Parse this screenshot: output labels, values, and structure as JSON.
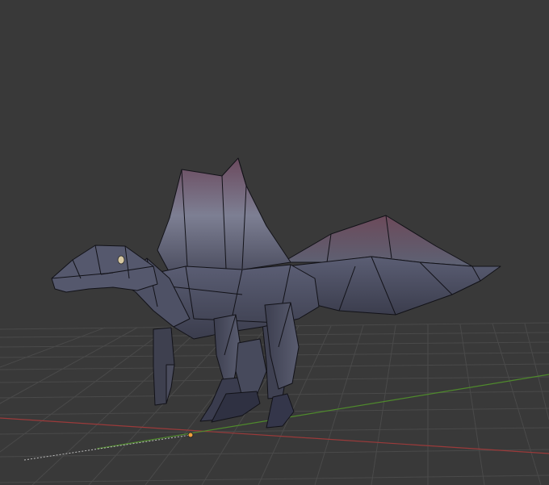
{
  "viewport": {
    "background": "#393939",
    "grid_color": "#4a4a4a",
    "axis_x_color": "#9b3a3a",
    "axis_y_color": "#4f8a2c",
    "origin_marker_color": "#f0a13a"
  },
  "model": {
    "name_semantic": "spinosaurus-low-poly-mesh",
    "shading": "textured-solid",
    "palette": {
      "body": "#4d4f63",
      "body_dark": "#2f3040",
      "sail": "#6a4a5c",
      "sail_light": "#8a8ea0",
      "edge": "#121218",
      "eye": "#d7c8a2"
    }
  }
}
